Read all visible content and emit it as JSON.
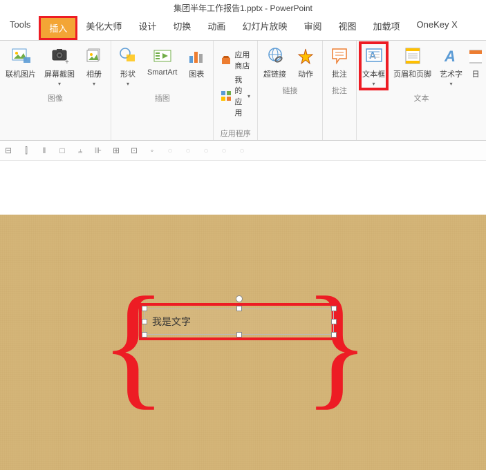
{
  "title": "集团半年工作报告1.pptx - PowerPoint",
  "tabs": {
    "tools": "Tools",
    "insert": "插入",
    "beautify": "美化大师",
    "design": "设计",
    "transition": "切换",
    "animation": "动画",
    "slideshow": "幻灯片放映",
    "review": "审阅",
    "view": "视图",
    "addons": "加载项",
    "onekey": "OneKey X"
  },
  "ribbon": {
    "images_group": {
      "local_image": "联机图片",
      "screenshot": "屏幕截图",
      "album": "相册",
      "label": "图像"
    },
    "illustration_group": {
      "shapes": "形状",
      "smartart": "SmartArt",
      "chart": "图表",
      "label": "插图"
    },
    "apps_group": {
      "app_store": "应用商店",
      "my_apps": "我的应用",
      "label": "应用程序"
    },
    "links_group": {
      "hyperlink": "超链接",
      "action": "动作",
      "label": "链接"
    },
    "notes_group": {
      "notes": "批注",
      "label": "批注"
    },
    "text_group": {
      "textbox": "文本框",
      "header_footer": "页眉和页脚",
      "wordart": "艺术字",
      "datetime": "日",
      "label": "文本"
    }
  },
  "slide": {
    "textbox_content": "我是文字"
  }
}
